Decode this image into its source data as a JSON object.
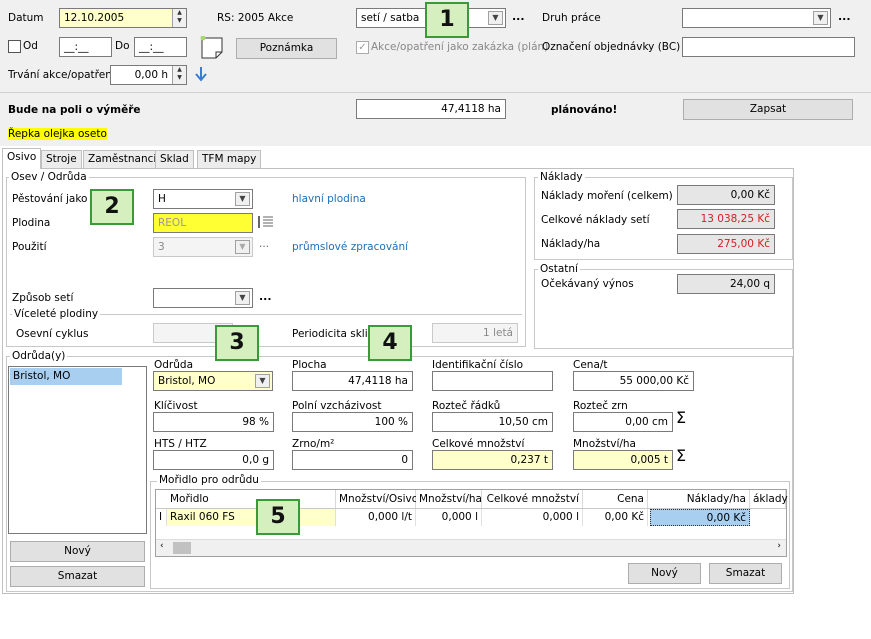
{
  "top": {
    "datum_label": "Datum",
    "datum_value": "12.10.2005",
    "rs_text": "RS: 2005 Akce",
    "method_value": "setí / satba",
    "druh_prace_label": "Druh práce",
    "od_label": "Od",
    "od_value": "__:__",
    "do_label": "Do",
    "do_value": "__:__",
    "poznamka_button": "Poznámka",
    "akce_checkbox_label": "Akce/opatření jako zakázka (plán)",
    "oznaceni_label": "Označení objednávky (BC)",
    "trvani_label": "Trvání akce/opatření",
    "trvani_value": "0,00 h",
    "vymera_label": "Bude na poli o výměře",
    "vymera_value": "47,4118 ha",
    "planovano": "plánováno!",
    "zapsat_button": "Zapsat",
    "status_text": "Řepka olejka oseto",
    "dots": "..."
  },
  "tabs": [
    "Osivo",
    "Stroje",
    "Zaměstnanci",
    "Sklad",
    "TFM mapy"
  ],
  "osev": {
    "title": "Osev / Odrůda",
    "pestovani_label": "Pěstování jako",
    "pestovani_value": "H",
    "pestovani_desc": "hlavní plodina",
    "plodina_label": "Plodina",
    "plodina_value": "REOL",
    "pouziti_label": "Použití",
    "pouziti_value": "3",
    "pouziti_desc": "průmslové zpracování",
    "zpusob_label": "Způsob setí",
    "zpusob_value": ""
  },
  "vicelete": {
    "title": "Víceleté plodiny",
    "cyklus_label": "Osevní cyklus",
    "cyklus_value": "",
    "periodicita_label": "Periodicita sklizn",
    "periodicita_value": "1 letá"
  },
  "naklady": {
    "title": "Náklady",
    "moreni_label": "Náklady moření (celkem)",
    "moreni_value": "0,00 Kč",
    "seti_label": "Celkové náklady setí",
    "seti_value": "13 038,25 Kč",
    "ha_label": "Náklady/ha",
    "ha_value": "275,00 Kč"
  },
  "ostatni": {
    "title": "Ostatní",
    "vynos_label": "Očekávaný výnos",
    "vynos_value": "24,00 q"
  },
  "odrudy": {
    "title": "Odrůda(y)",
    "items": [
      "Bristol, MO"
    ],
    "novy_button": "Nový",
    "smazat_button": "Smazat"
  },
  "detail": {
    "odruda_label": "Odrůda",
    "odruda_value": "Bristol, MO",
    "plocha_label": "Plocha",
    "plocha_value": "47,4118 ha",
    "id_label": "Identifikační číslo",
    "id_value": "",
    "cena_label": "Cena/t",
    "cena_value": "55 000,00 Kč",
    "klicivost_label": "Klíčivost",
    "klicivost_value": "98 %",
    "polni_label": "Polní vzcházivost",
    "polni_value": "100 %",
    "roztec_r_label": "Rozteč řádků",
    "roztec_r_value": "10,50 cm",
    "roztec_z_label": "Rozteč zrn",
    "roztec_z_value": "0,00 cm",
    "hts_label": "HTS / HTZ",
    "hts_value": "0,0 g",
    "zrno_label": "Zrno/m²",
    "zrno_value": "0",
    "celk_label": "Celkové množství",
    "celk_value": "0,237 t",
    "mnozstvi_label": "Množství/ha",
    "mnozstvi_value": "0,005 t",
    "sigma": "Σ"
  },
  "moridlo": {
    "title": "Mořidlo pro odrůdu",
    "columns": [
      "Mořidlo",
      "Množství/Osivo",
      "Množství/ha",
      "Celkové množství",
      "Cena",
      "Náklady/ha",
      "áklady"
    ],
    "row": {
      "name": "Raxil 060 FS",
      "osivo": "0,000 l/t",
      "ha": "0,000 l",
      "celk": "0,000 l",
      "cena": "0,00 Kč",
      "naklady": "0,00 Kč"
    },
    "novy_button": "Nový",
    "smazat_button": "Smazat",
    "cursor": "I"
  },
  "badges": [
    "1",
    "2",
    "3",
    "4",
    "5"
  ]
}
